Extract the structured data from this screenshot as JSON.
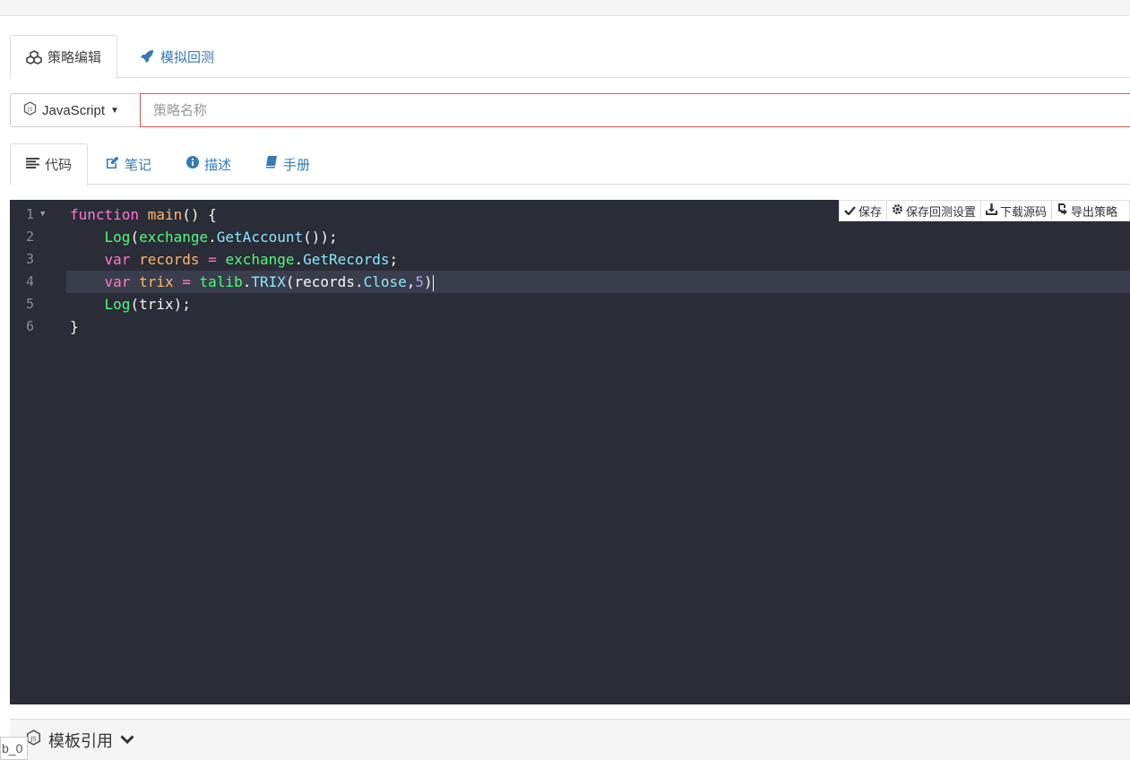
{
  "main_tabs": [
    {
      "label": "策略编辑",
      "icon": "cubes-icon",
      "active": true
    },
    {
      "label": "模拟回测",
      "icon": "rocket-icon",
      "active": false
    }
  ],
  "language": {
    "label": "JavaScript",
    "icon": "js-icon"
  },
  "strategy_name": {
    "value": "",
    "placeholder": "策略名称"
  },
  "sub_tabs": [
    {
      "label": "代码",
      "icon": "list-icon",
      "active": true
    },
    {
      "label": "笔记",
      "icon": "edit-icon",
      "active": false
    },
    {
      "label": "描述",
      "icon": "info-icon",
      "active": false
    },
    {
      "label": "手册",
      "icon": "book-icon",
      "active": false
    }
  ],
  "toolbar": {
    "save": "保存",
    "save_backtest": "保存回测设置",
    "download": "下载源码",
    "export": "导出策略"
  },
  "code_lines": [
    {
      "n": "1",
      "text": "function main() {"
    },
    {
      "n": "2",
      "text": "    Log(exchange.GetAccount());"
    },
    {
      "n": "3",
      "text": "    var records = exchange.GetRecords;"
    },
    {
      "n": "4",
      "text": "    var trix = talib.TRIX(records.Close,5)"
    },
    {
      "n": "5",
      "text": "    Log(trix);"
    },
    {
      "n": "6",
      "text": "}"
    }
  ],
  "template_panel": {
    "label": "模板引用"
  },
  "corner_label": "b_0",
  "colors": {
    "accent": "#337ab7",
    "editor_bg": "#2a2c37",
    "error_border": "#d9534f"
  }
}
